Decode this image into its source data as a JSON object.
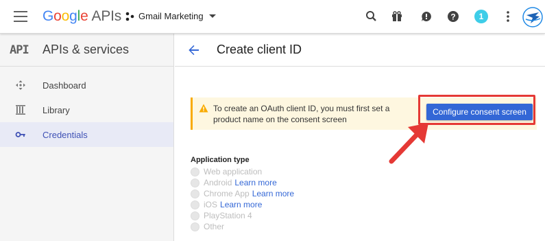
{
  "header": {
    "logo_letters": [
      "G",
      "o",
      "o",
      "g",
      "l",
      "e"
    ],
    "logo_suffix": "APIs",
    "project_name": "Gmail Marketing",
    "notification_count": "1",
    "icons": [
      "menu-icon",
      "search-icon",
      "gift-icon",
      "alert-icon",
      "help-icon",
      "notifications-badge",
      "more-vert-icon",
      "account-avatar"
    ]
  },
  "sidebar": {
    "api_mark": "API",
    "title": "APIs & services",
    "items": [
      {
        "label": "Dashboard",
        "icon": "dashboard-icon",
        "active": false
      },
      {
        "label": "Library",
        "icon": "library-icon",
        "active": false
      },
      {
        "label": "Credentials",
        "icon": "key-icon",
        "active": true
      }
    ]
  },
  "main": {
    "title": "Create client ID",
    "alert_text": "To create an OAuth client ID, you must first set a product name on the consent screen",
    "consent_button": "Configure consent screen",
    "app_type_label": "Application type",
    "options": [
      {
        "label": "Web application",
        "learn": ""
      },
      {
        "label": "Android",
        "learn": "Learn more"
      },
      {
        "label": "Chrome App",
        "learn": "Learn more"
      },
      {
        "label": "iOS",
        "learn": "Learn more"
      },
      {
        "label": "PlayStation 4",
        "learn": ""
      },
      {
        "label": "Other",
        "learn": ""
      }
    ]
  },
  "colors": {
    "accent": "#3367d6",
    "active_nav": "#e8eaf6",
    "warning": "#f9ab00",
    "highlight_red": "#e53935",
    "badge": "#3ecde8"
  }
}
